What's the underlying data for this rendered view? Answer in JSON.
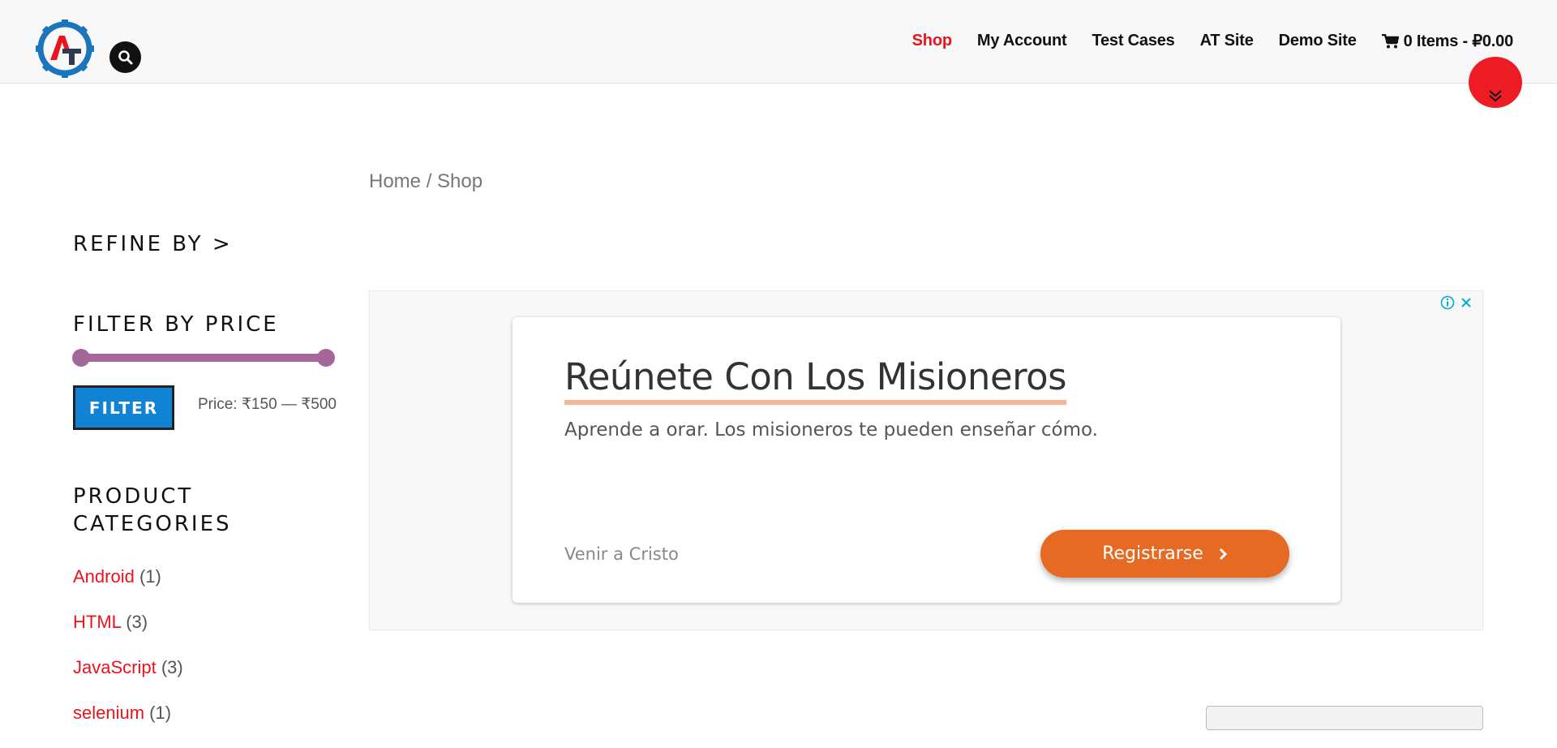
{
  "header": {
    "nav": [
      {
        "label": "Shop",
        "active": true
      },
      {
        "label": "My Account",
        "active": false
      },
      {
        "label": "Test Cases",
        "active": false
      },
      {
        "label": "AT Site",
        "active": false
      },
      {
        "label": "Demo Site",
        "active": false
      }
    ],
    "cart_label": "0 Items - ₽0.00",
    "icons": {
      "logo": "at-gear-logo",
      "search": "search-icon",
      "cart": "cart-icon",
      "scroll": "chevron-double-down-icon"
    },
    "colors": {
      "accent": "#e8141e",
      "header_bg": "#f8f8f8"
    }
  },
  "breadcrumb": {
    "home": "Home",
    "separator": " / ",
    "current": "Shop"
  },
  "sidebar": {
    "refine_title": "REFINE BY >",
    "price_title": "FILTER BY PRICE",
    "filter_button": "FILTER",
    "price_label": "Price: ₹150 — ₹500",
    "slider": {
      "min_position": 0,
      "max_position": 1,
      "color": "#a5679a"
    },
    "categories_title": "PRODUCT CATEGORIES",
    "categories": [
      {
        "name": "Android",
        "count": "(1)"
      },
      {
        "name": "HTML",
        "count": "(3)"
      },
      {
        "name": "JavaScript",
        "count": "(3)"
      },
      {
        "name": "selenium",
        "count": "(1)"
      }
    ]
  },
  "ad": {
    "title": "Reúnete Con Los Misioneros",
    "subtitle": "Aprende a orar. Los misioneros te pueden enseñar cómo.",
    "source": "Venir a Cristo",
    "cta": "Registrarse",
    "icons": {
      "info": "info-icon",
      "close": "close-icon",
      "cta": "chevron-right-icon"
    },
    "colors": {
      "cta": "#e76a24",
      "underline": "#f2b596"
    }
  }
}
